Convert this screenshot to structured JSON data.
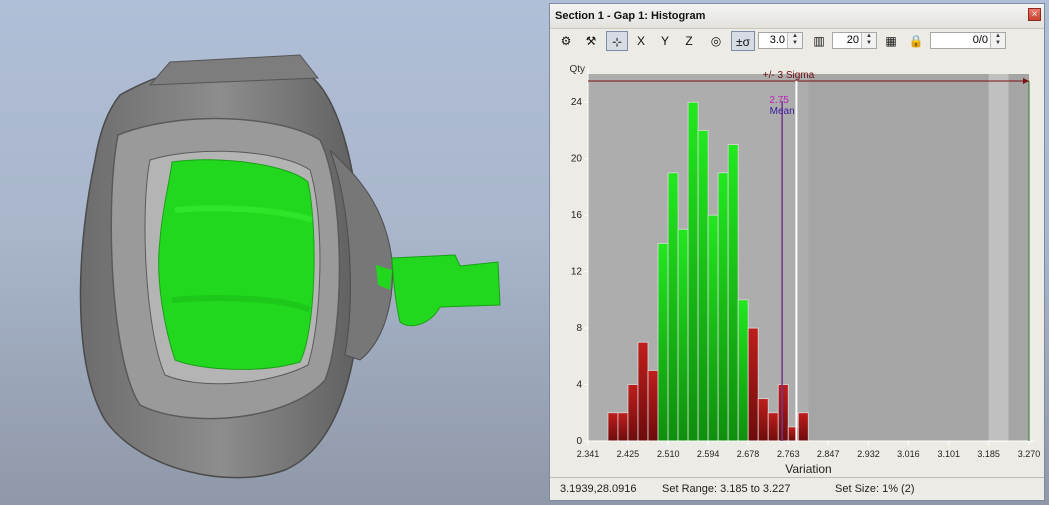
{
  "panel": {
    "title": "Section 1 - Gap 1: Histogram",
    "close_label": "×"
  },
  "toolbar": {
    "sigma_button": "±σ",
    "sigma_value": "3.0",
    "bins_value": "20",
    "ratio_value": "0/0",
    "x_button": "X",
    "y_button": "Y",
    "z_button": "Z"
  },
  "chart_data": {
    "type": "bar",
    "y_axis_title": "Qty",
    "xlabel": "Variation",
    "x_ticks": [
      "2.341",
      "2.425",
      "2.510",
      "2.594",
      "2.678",
      "2.763",
      "2.847",
      "2.932",
      "3.016",
      "3.101",
      "3.185",
      "3.270"
    ],
    "xlim": [
      2.341,
      3.27
    ],
    "ylim": [
      0,
      26
    ],
    "y_ticks": [
      "0",
      "4",
      "8",
      "12",
      "16",
      "20",
      "24"
    ],
    "bin_start": 2.383,
    "bin_width": 0.0211,
    "values": [
      2,
      2,
      4,
      7,
      5,
      14,
      19,
      15,
      24,
      22,
      16,
      19,
      21,
      10,
      8,
      3,
      2,
      4,
      1,
      2
    ],
    "in_range": [
      false,
      false,
      false,
      false,
      false,
      true,
      true,
      true,
      true,
      true,
      true,
      true,
      true,
      true,
      false,
      false,
      false,
      false,
      false,
      false
    ],
    "colors": {
      "in_range": "#22e81f",
      "out_of_range": "#bf1e1c",
      "background": "#a5a5a5",
      "sigma_line": "#7a1010"
    },
    "sigma_label": "+/- 3 Sigma",
    "mean_label": "Mean",
    "mean_value_label": "2.75",
    "mean_value": 2.78,
    "mean_marker": 2.75,
    "sigma_low": 2.341,
    "sigma_high": 3.27,
    "highlight_range": [
      3.185,
      3.227
    ]
  },
  "status": {
    "coords": "3.1939,28.0916",
    "set_range": "Set Range: 3.185 to 3.227",
    "set_size": "Set Size: 1% (2)"
  }
}
